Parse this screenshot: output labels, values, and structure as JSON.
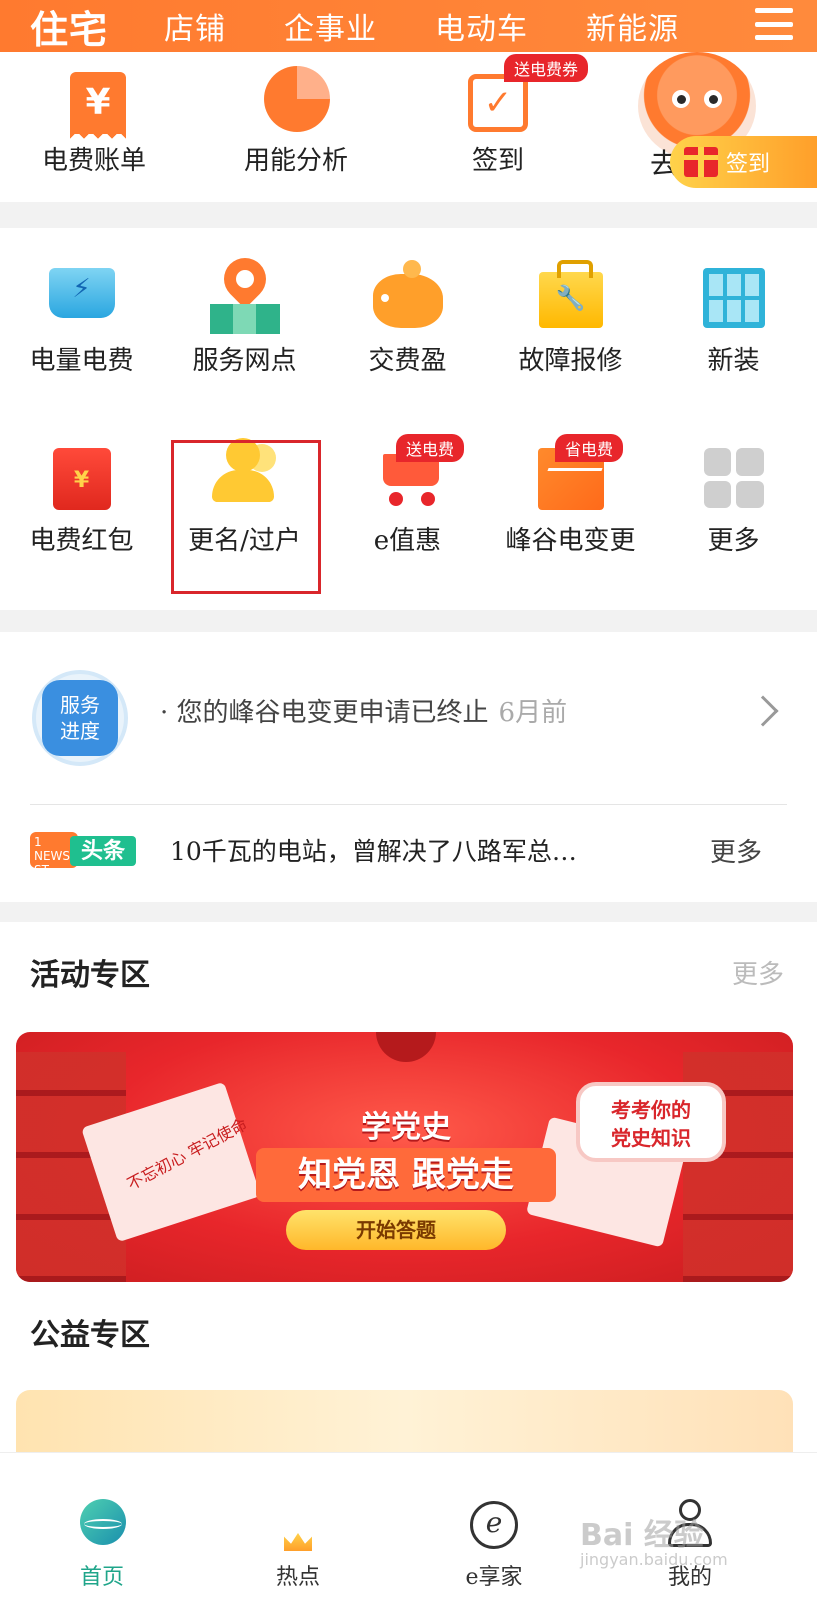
{
  "top_tabs": [
    "住宅",
    "店铺",
    "企事业",
    "电动车",
    "新能源"
  ],
  "quick_actions": [
    {
      "label": "电费账单",
      "icon": "bill-icon"
    },
    {
      "label": "用能分析",
      "icon": "pie-chart-icon"
    },
    {
      "label": "签到",
      "icon": "calendar-check-icon",
      "badge": "送电费券"
    }
  ],
  "mascot": {
    "partial_text": "去",
    "signin_label": "签到"
  },
  "services": [
    {
      "label": "电量电费",
      "icon": "power-screen-icon"
    },
    {
      "label": "服务网点",
      "icon": "map-pin-icon"
    },
    {
      "label": "交费盈",
      "icon": "piggy-bank-icon"
    },
    {
      "label": "故障报修",
      "icon": "toolbox-icon"
    },
    {
      "label": "新装",
      "icon": "solar-panel-icon"
    },
    {
      "label": "电费红包",
      "icon": "red-envelope-icon"
    },
    {
      "label": "更名/过户",
      "icon": "user-edit-icon"
    },
    {
      "label": "e值惠",
      "icon": "shopping-cart-icon",
      "badge": "送电费",
      "cart_text": "送电费"
    },
    {
      "label": "峰谷电变更",
      "icon": "peak-valley-icon",
      "badge": "省电费"
    },
    {
      "label": "更多",
      "icon": "grid-more-icon"
    }
  ],
  "progress": {
    "badge": [
      "服务",
      "进度"
    ],
    "text": "·  您的峰谷电变更申请已终止",
    "time": "6月前"
  },
  "news": {
    "logo_small": [
      "1",
      "NEWS",
      "ST"
    ],
    "logo_label": "头条",
    "headline": "10千瓦的电站，曾解决了八路军总…",
    "more": "更多"
  },
  "activity": {
    "title": "活动专区",
    "more": "更多",
    "banner": {
      "title1": "学党史",
      "title2": "知党恩  跟党走",
      "button": "开始答题",
      "bubble": [
        "考考你的",
        "党史知识"
      ],
      "book_text": "不忘初心 牢记使命"
    }
  },
  "charity": {
    "title": "公益专区"
  },
  "bottom_nav": [
    {
      "label": "首页",
      "icon": "globe-icon",
      "active": true
    },
    {
      "label": "热点",
      "icon": "crown-icon"
    },
    {
      "label": "e享家",
      "icon": "e-leaf-icon"
    },
    {
      "label": "我的",
      "icon": "person-icon"
    }
  ],
  "watermark": {
    "main": "Bai 经验",
    "sub": "jingyan.baidu.com"
  },
  "colors": {
    "brand_orange": "#ff7a2f",
    "highlight_red": "#d9262b",
    "active_green": "#1fa58a"
  }
}
